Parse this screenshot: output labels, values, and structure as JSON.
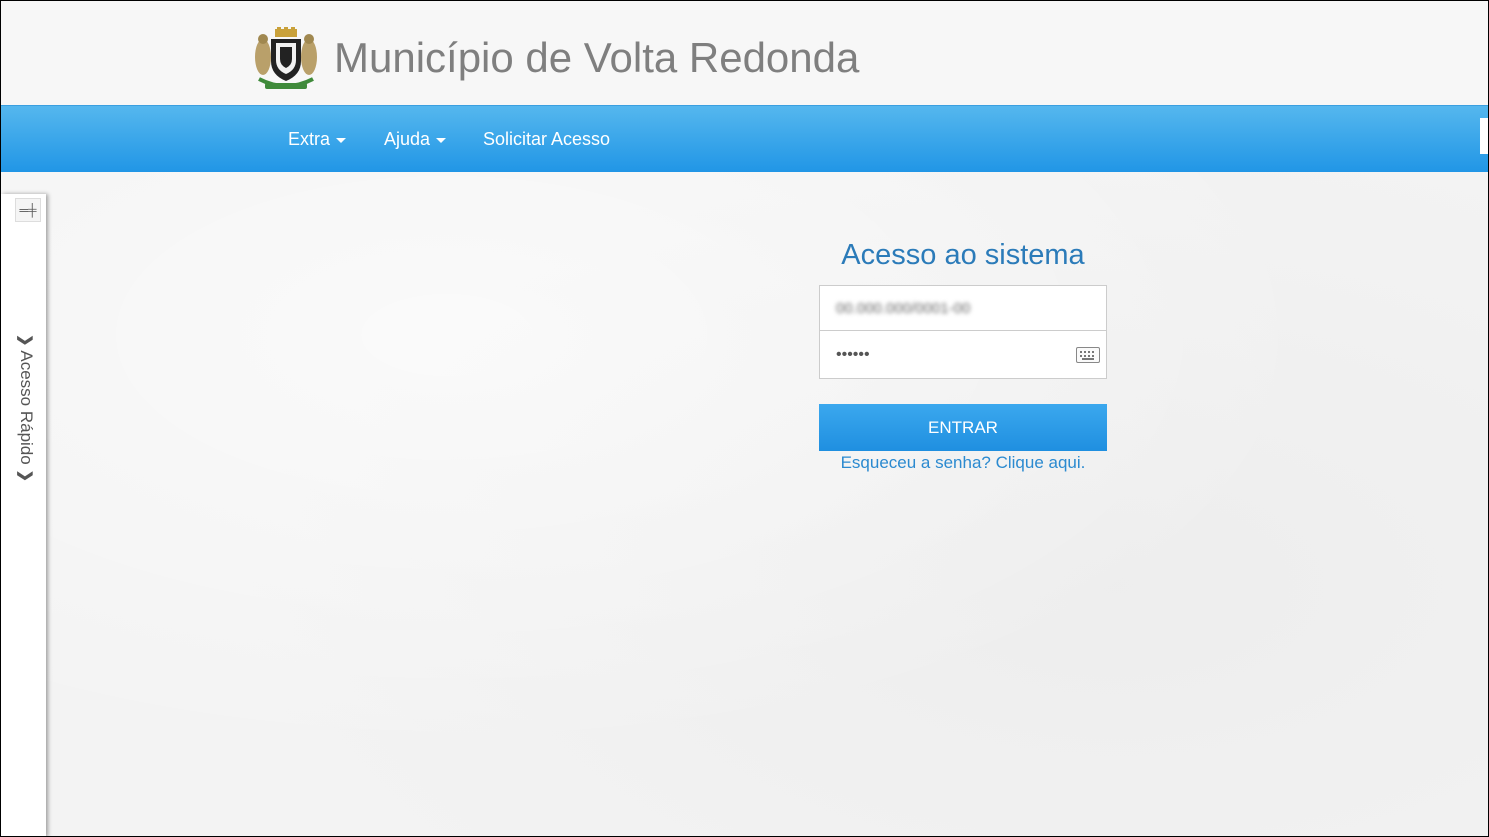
{
  "header": {
    "title": "Município de Volta Redonda",
    "logo_icon": "municipal-coat-of-arms"
  },
  "nav": {
    "items": [
      {
        "label": "Extra",
        "dropdown": true
      },
      {
        "label": "Ajuda",
        "dropdown": true
      },
      {
        "label": "Solicitar Acesso",
        "dropdown": false
      }
    ]
  },
  "side_panel": {
    "label": "Acesso Rápido",
    "pin_icon": "pin-icon"
  },
  "login": {
    "title": "Acesso ao sistema",
    "username_value": "00.000.000/0001-00",
    "password_value": "••••••",
    "keyboard_icon": "keyboard-icon",
    "submit_label": "ENTRAR",
    "forgot_label": "Esqueceu a senha? Clique aqui."
  },
  "colors": {
    "navbar": "#2196e6",
    "accent_text": "#2b7bb9",
    "title_gray": "#7f7f7f"
  }
}
